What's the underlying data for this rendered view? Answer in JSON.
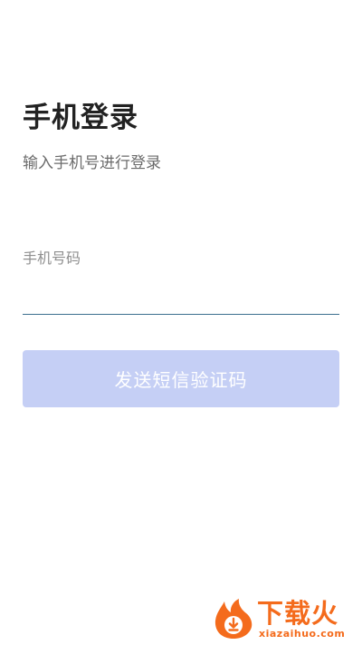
{
  "login": {
    "title": "手机登录",
    "subtitle": "输入手机号进行登录",
    "phone_label": "手机号码",
    "phone_value": "",
    "send_code_label": "发送短信验证码"
  },
  "watermark": {
    "brand": "下载火",
    "url": "xiazaihuo.com",
    "icon": "flame-download-logo-icon"
  },
  "colors": {
    "title": "#222222",
    "subtitle": "#6b6b6b",
    "label": "#8f8f8f",
    "underline": "#3c6f8f",
    "button_disabled_bg": "#c5cff5",
    "button_text": "#ffffff",
    "watermark": "#f46b1c"
  }
}
